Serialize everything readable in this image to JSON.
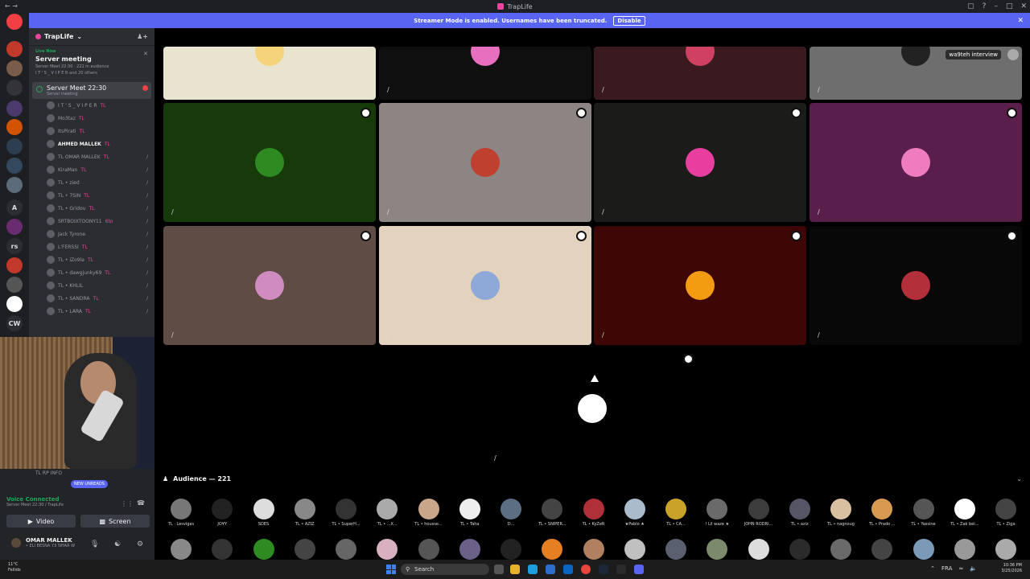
{
  "window": {
    "title": "TrapLife",
    "left_icons": "← →"
  },
  "banner": {
    "text": "Streamer Mode is enabled. Usernames have been truncated.",
    "button": "Disable",
    "close": "✕"
  },
  "guilds": [
    {
      "label": "",
      "color": "#f23f43",
      "badge": true
    },
    {
      "label": "",
      "color": "#c0392b",
      "badge": true
    },
    {
      "label": "",
      "color": "#7a5c4a",
      "badge": true
    },
    {
      "label": "",
      "color": "#333338",
      "badge": true
    },
    {
      "label": "",
      "color": "#4b3a6b",
      "badge": true
    },
    {
      "label": "",
      "color": "#d35400",
      "badge": true
    },
    {
      "label": "",
      "color": "#2c3e50",
      "badge": true
    },
    {
      "label": "",
      "color": "#34495e",
      "badge": false
    },
    {
      "label": "",
      "color": "#5b6b7a",
      "badge": true
    },
    {
      "label": "A",
      "color": "#2b2d31",
      "badge": false
    },
    {
      "label": "",
      "color": "#6a2c70",
      "badge": true
    },
    {
      "label": "rs",
      "color": "#2b2d31",
      "badge": false
    },
    {
      "label": "",
      "color": "#c0392b",
      "badge": true
    },
    {
      "label": "",
      "color": "#555",
      "badge": true
    },
    {
      "label": "",
      "color": "#ffffff",
      "badge": true
    },
    {
      "label": "CW",
      "color": "#2b2d31",
      "badge": false
    }
  ],
  "server": {
    "name": "TrapLife",
    "live_label": "Live Now",
    "live_title": "Server meeting",
    "live_sub": "Server Meet 22:30 · 221 in audience",
    "live_sub2": "I T ' S _ V I P E R and 20 others",
    "stage_title": "Server Meet 22:30",
    "stage_sub": "Server meeting"
  },
  "members": [
    {
      "name": "I T ' S _ V I P E R",
      "tag": "TL",
      "bold": false,
      "muted": false
    },
    {
      "name": "Mo3taz",
      "tag": "TL",
      "bold": false,
      "muted": false
    },
    {
      "name": "ItsPirati",
      "tag": "TL",
      "bold": false,
      "muted": false
    },
    {
      "name": "AHMED MALLEK",
      "tag": "TL",
      "bold": true,
      "muted": false
    },
    {
      "name": "TL OMAR MALLEK",
      "tag": "TL",
      "bold": false,
      "muted": true
    },
    {
      "name": "KiraMan",
      "tag": "TL",
      "bold": false,
      "muted": true
    },
    {
      "name": "TL • zied",
      "tag": "",
      "bold": false,
      "muted": true
    },
    {
      "name": "TL • 7SIN",
      "tag": "TL",
      "bold": false,
      "muted": true
    },
    {
      "name": "TL • Gridou",
      "tag": "TL",
      "bold": false,
      "muted": true
    },
    {
      "name": "SRTBOIXTOONY11",
      "tag": "6to",
      "bold": false,
      "muted": true
    },
    {
      "name": "Jack Tyrone",
      "tag": "",
      "bold": false,
      "muted": true
    },
    {
      "name": "L'FERSSI",
      "tag": "TL",
      "bold": false,
      "muted": true
    },
    {
      "name": "TL • iZo9la",
      "tag": "TL",
      "bold": false,
      "muted": true
    },
    {
      "name": "TL • dawgjunky69",
      "tag": "TL",
      "bold": false,
      "muted": true
    },
    {
      "name": "TL • KHLIL",
      "tag": "",
      "bold": false,
      "muted": true
    },
    {
      "name": "TL • SANDRA",
      "tag": "TL",
      "bold": false,
      "muted": true
    },
    {
      "name": "TL • LARA",
      "tag": "TL",
      "bold": false,
      "muted": true
    }
  ],
  "user_panel": {
    "channel_hint": "TL RP INFO",
    "new_unreads": "NEW UNREADS",
    "voice_status": "Voice Connected",
    "voice_channel": "Server Meet 22:30 / TrapLife",
    "video_btn": "Video",
    "screen_btn": "Screen",
    "username": "OMAR MALLEK",
    "user_status": "• ELI BESNA Y.Il NHAR W"
  },
  "tiles": [
    {
      "bg": "#e8e4d0",
      "avatar": "#f4d37a",
      "eye": false,
      "label": ""
    },
    {
      "bg": "#0f0f0f",
      "avatar": "#e86ec0",
      "eye": false,
      "label": ""
    },
    {
      "bg": "#3a1a1e",
      "avatar": "#d04060",
      "eye": false,
      "label": ""
    },
    {
      "bg": "#6e6e6e",
      "avatar": "#222",
      "eye": false,
      "label": "wa9teh interview"
    },
    {
      "bg": "#173a0b",
      "avatar": "#2e8b22",
      "eye": true,
      "label": ""
    },
    {
      "bg": "#8d8584",
      "avatar": "#c04030",
      "eye": true,
      "label": ""
    },
    {
      "bg": "#1b1c1a",
      "avatar": "#e83e9f",
      "eye": true,
      "label": ""
    },
    {
      "bg": "#5a1e4a",
      "avatar": "#f07cc0",
      "eye": true,
      "label": ""
    },
    {
      "bg": "#5e4c45",
      "avatar": "#d08cc0",
      "eye": true,
      "label": ""
    },
    {
      "bg": "#e3d3be",
      "avatar": "#8ea8d8",
      "eye": true,
      "label": ""
    },
    {
      "bg": "#3c0704",
      "avatar": "#f39c12",
      "eye": true,
      "label": ""
    },
    {
      "bg": "#080808",
      "avatar": "#b3303a",
      "eye": true,
      "label": ""
    },
    {
      "bg": "#000000",
      "avatar": "#ffffff",
      "eye": true,
      "label": ""
    }
  ],
  "audience": {
    "title": "Audience — 221",
    "row1": [
      "TL · Lesvigas",
      "JO¥Y",
      "SDES",
      "TL • AZIZ",
      "TL • SuperH...",
      "TL • ...X...",
      "TL • housse...",
      "TL • Taha",
      "D...",
      "TL • SNIPER...",
      "TL • KyZeR",
      "★Pablo ★",
      "TL • CA...",
      "! Lil waze ★",
      "JOHN RODRI...",
      "TL • aziz",
      "TL • nagnoug",
      "TL • Prado ...",
      "TL • Yassine",
      "TL • Zak bel...",
      "TL • Ziga"
    ],
    "row1_colors": [
      "#777",
      "#222",
      "#ddd",
      "#888",
      "#333",
      "#aaa",
      "#c9a58a",
      "#eee",
      "#5b6e82",
      "#444",
      "#b0303a",
      "#aabbcc",
      "#c9a227",
      "#6a6a6a",
      "#3c3c3c",
      "#556",
      "#d8c0a0",
      "#d89a50",
      "#555",
      "#fff",
      "#444"
    ],
    "row2_colors": [
      "#888",
      "#333",
      "#2e8b22",
      "#444",
      "#666",
      "#d8b0c0",
      "#555",
      "#6a6088",
      "#222",
      "#e67e22",
      "#b08060",
      "#c0c0c0",
      "#5a6070",
      "#7a8a6a",
      "#ddd",
      "#2b2b2b",
      "#6a6a6a",
      "#444",
      "#7a9ab8",
      "#999",
      "#aaa"
    ]
  },
  "taskbar": {
    "weather": "11°C",
    "weather_sub": "Fellids",
    "search": "Search",
    "lang": "FRA",
    "time": "10:36 PM",
    "date": "3/25/2026"
  }
}
